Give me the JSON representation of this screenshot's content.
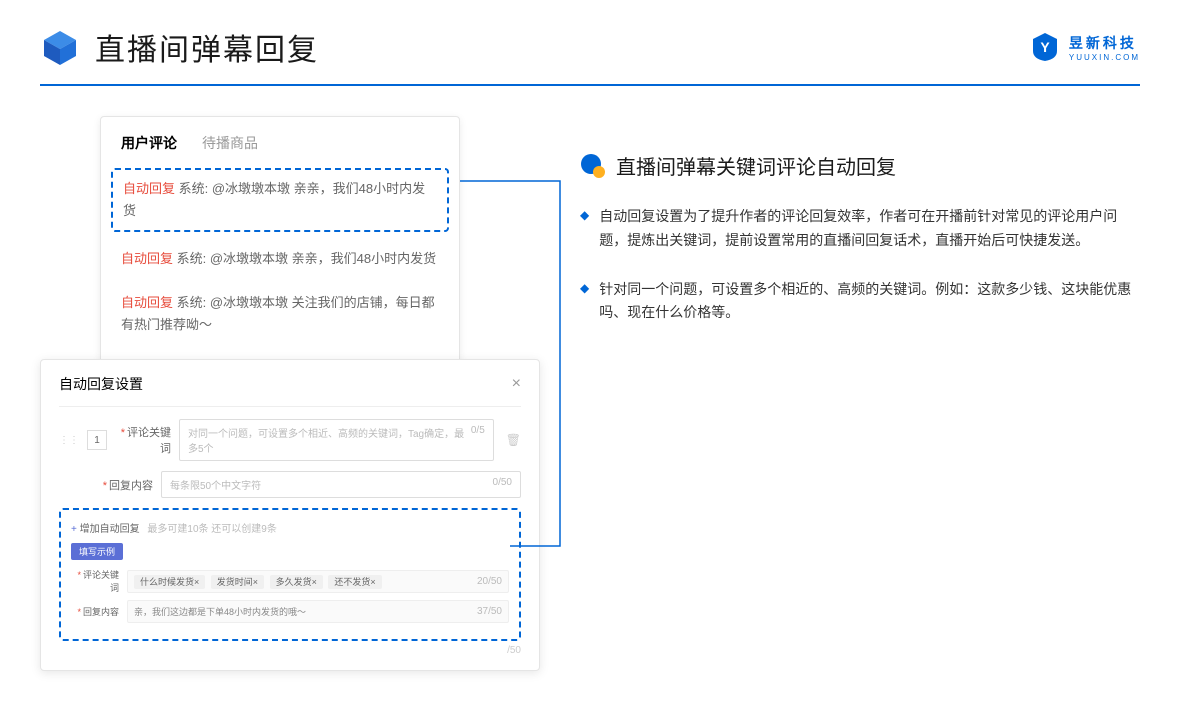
{
  "header": {
    "title": "直播间弹幕回复",
    "brand_cn": "昱新科技",
    "brand_en": "YUUXIN.COM"
  },
  "comments": {
    "tabs": [
      "用户评论",
      "待播商品"
    ],
    "items": [
      {
        "tag": "自动回复",
        "text": "系统: @冰墩墩本墩 亲亲，我们48小时内发货",
        "hl": true
      },
      {
        "tag": "自动回复",
        "text": "系统: @冰墩墩本墩 亲亲，我们48小时内发货",
        "hl": false
      },
      {
        "tag": "自动回复",
        "text": "系统: @冰墩墩本墩 关注我们的店铺，每日都有热门推荐呦～",
        "hl": false
      }
    ]
  },
  "settings": {
    "title": "自动回复设置",
    "row_num": "1",
    "kw_label": "评论关键词",
    "kw_placeholder": "对同一个问题，可设置多个相近、高频的关键词，Tag确定，最多5个",
    "kw_count": "0/5",
    "content_label": "回复内容",
    "content_placeholder": "每条限50个中文字符",
    "content_count": "0/50",
    "add_link": "增加自动回复",
    "add_hint": "最多可建10条 还可以创建9条",
    "example_badge": "填写示例",
    "ex_kw_label": "评论关键词",
    "ex_tags": [
      "什么时候发货×",
      "发货时间×",
      "多久发货×",
      "还不发货×"
    ],
    "ex_kw_count": "20/50",
    "ex_content_label": "回复内容",
    "ex_content_text": "亲，我们这边都是下单48小时内发货的哦～",
    "ex_content_count": "37/50",
    "outer_count": "/50"
  },
  "right": {
    "section_title": "直播间弹幕关键词评论自动回复",
    "bullets": [
      "自动回复设置为了提升作者的评论回复效率，作者可在开播前针对常见的评论用户问题，提炼出关键词，提前设置常用的直播间回复话术，直播开始后可快捷发送。",
      "针对同一个问题，可设置多个相近的、高频的关键词。例如：这款多少钱、这块能优惠吗、现在什么价格等。"
    ]
  }
}
